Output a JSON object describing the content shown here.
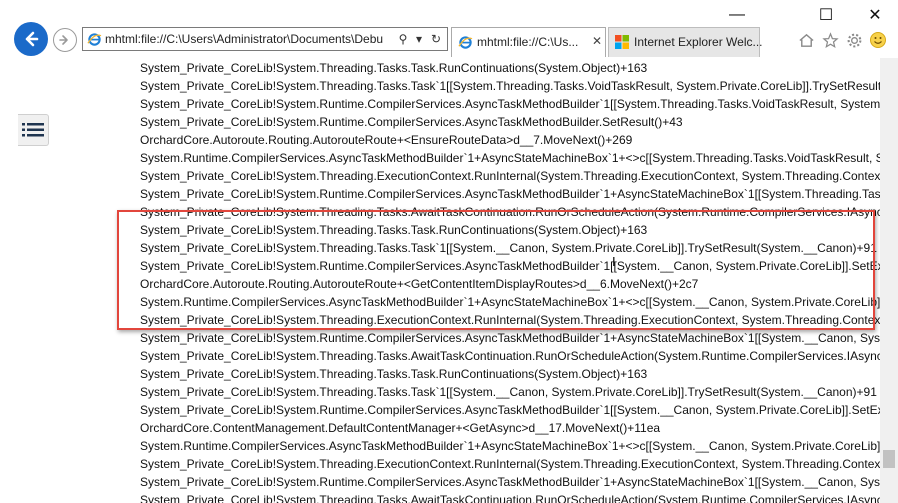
{
  "window": {
    "minimize": "—",
    "maximize": "☐",
    "close": "✕"
  },
  "address": {
    "value": "mhtml:file://C:\\Users\\Administrator\\Documents\\Debu",
    "search_glyph": "⚲",
    "dropdown_glyph": "▾",
    "refresh_glyph": "↻"
  },
  "tabs": [
    {
      "label": "mhtml:file://C:\\Us...",
      "close": "✕"
    },
    {
      "label": "Internet Explorer Welc..."
    }
  ],
  "content_lines": [
    "System_Private_CoreLib!System.Threading.Tasks.Task.RunContinuations(System.Object)+163",
    "System_Private_CoreLib!System.Threading.Tasks.Task`1[[System.Threading.Tasks.VoidTaskResult, System.Private.CoreLib]].TrySetResult(System",
    "System_Private_CoreLib!System.Runtime.CompilerServices.AsyncTaskMethodBuilder`1[[System.Threading.Tasks.VoidTaskResult, System.Priva",
    "System_Private_CoreLib!System.Runtime.CompilerServices.AsyncTaskMethodBuilder.SetResult()+43",
    "OrchardCore.Autoroute.Routing.AutorouteRoute+<EnsureRouteData>d__7.MoveNext()+269",
    "System.Runtime.CompilerServices.AsyncTaskMethodBuilder`1+AsyncStateMachineBox`1+<>c[[System.Threading.Tasks.VoidTaskResult, Syste",
    "System_Private_CoreLib!System.Threading.ExecutionContext.RunInternal(System.Threading.ExecutionContext, System.Threading.ContextCallb",
    "System_Private_CoreLib!System.Runtime.CompilerServices.AsyncTaskMethodBuilder`1+AsyncStateMachineBox`1[[System.Threading.Tasks.VoidTaskResult, System.Pr",
    "System_Private_CoreLib!System.Threading.Tasks.AwaitTaskContinuation.RunOrScheduleAction(System.Runtime.CompilerServices.IAsyncSta",
    "System_Private_CoreLib!System.Threading.Tasks.Task.RunContinuations(System.Object)+163",
    "System_Private_CoreLib!System.Threading.Tasks.Task`1[[System.__Canon, System.Private.CoreLib]].TrySetResult(System.__Canon)+91",
    "System_Private_CoreLib!System.Runtime.CompilerServices.AsyncTaskMethodBuilder`1[[System.__Canon, System.Private.CoreLib]].SetExisting",
    "OrchardCore.Autoroute.Routing.AutorouteRoute+<GetContentItemDisplayRoutes>d__6.MoveNext()+2c7",
    "System.Runtime.CompilerServices.AsyncTaskMethodBuilder`1+AsyncStateMachineBox`1+<>c[[System.__Canon, System.Private.CoreLib],[Or",
    "System_Private_CoreLib!System.Threading.ExecutionContext.RunInternal(System.Threading.ExecutionContext, System.Threading.ContextCall",
    "System_Private_CoreLib!System.Runtime.CompilerServices.AsyncTaskMethodBuilder`1+AsyncStateMachineBox`1[[System.__Canon, System.Private.CoreLib],[Orchard",
    "System_Private_CoreLib!System.Threading.Tasks.AwaitTaskContinuation.RunOrScheduleAction(System.Runtime.CompilerServices.IAsyncState",
    "System_Private_CoreLib!System.Threading.Tasks.Task.RunContinuations(System.Object)+163",
    "System_Private_CoreLib!System.Threading.Tasks.Task`1[[System.__Canon, System.Private.CoreLib]].TrySetResult(System.__Canon)+91",
    "System_Private_CoreLib!System.Runtime.CompilerServices.AsyncTaskMethodBuilder`1[[System.__Canon, System.Private.CoreLib]].SetExisting",
    "OrchardCore.ContentManagement.DefaultContentManager+<GetAsync>d__17.MoveNext()+11ea",
    "System.Runtime.CompilerServices.AsyncTaskMethodBuilder`1+AsyncStateMachineBox`1+<>c[[System.__Canon, System.Private.CoreLib],[Orc",
    "System_Private_CoreLib!System.Threading.ExecutionContext.RunInternal(System.Threading.ExecutionContext, System.Threading.ContextCallb",
    "System_Private_CoreLib!System.Runtime.CompilerServices.AsyncTaskMethodBuilder`1+AsyncStateMachineBox`1[[System.__Canon, System.Private.CoreLib],[OrchardC",
    "System_Private_CoreLib!System.Threading.Tasks.AwaitTaskContinuation.RunOrScheduleAction(System.Runtime.CompilerServices.IAsyncSta"
  ],
  "colors": {
    "accent": "#1b6ac9",
    "highlight_box": "#e2463c"
  }
}
